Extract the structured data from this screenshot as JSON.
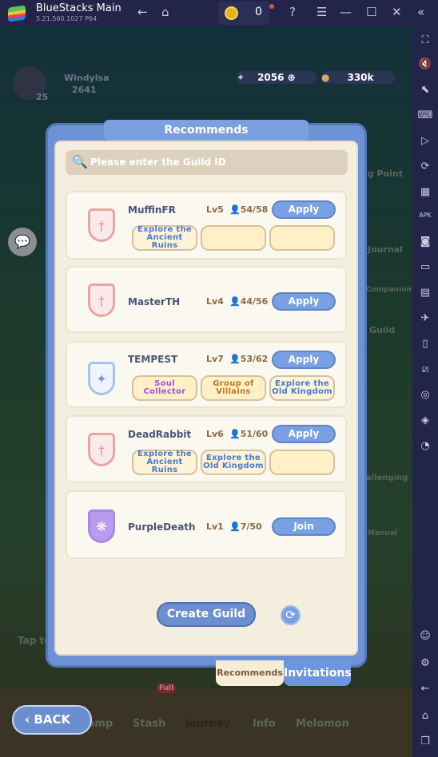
{
  "window": {
    "title": "BlueStacks Main",
    "version": "5.21.560.1027  P64",
    "coins": "0"
  },
  "hud": {
    "player_name": "Windylsa",
    "power": "2641",
    "level": "25",
    "gems": "2056",
    "gold": "330k",
    "chat_placeholder": "Tap to",
    "side_labels": [
      "Journal",
      "Companion",
      "Guild",
      "Manual",
      "allenging",
      "ng Point"
    ],
    "nav": [
      "Camp",
      "Stash",
      "Journey",
      "Info",
      "Melomon"
    ],
    "stash_badge": "Full"
  },
  "dialog": {
    "title": "Recommends",
    "search_placeholder": "Please enter the Guild ID",
    "guilds": [
      {
        "name": "MuffinFR",
        "level": "Lv5",
        "members": "54/58",
        "action": "Apply",
        "tags": [
          "Explore the Ancient Ruins",
          "",
          ""
        ]
      },
      {
        "name": "MasterTH",
        "level": "Lv4",
        "members": "44/56",
        "action": "Apply",
        "tags": []
      },
      {
        "name": "TEMPEST",
        "level": "Lv7",
        "members": "53/62",
        "action": "Apply",
        "tags": [
          "Soul Collector",
          "Group of Villains",
          "Explore the Old Kingdom"
        ]
      },
      {
        "name": "DeadRabbit",
        "level": "Lv6",
        "members": "51/60",
        "action": "Apply",
        "tags": [
          "Explore the Ancient Ruins",
          "Explore the Old Kingdom",
          ""
        ]
      },
      {
        "name": "PurpleDeath",
        "level": "Lv1",
        "members": "7/50",
        "action": "Join",
        "tags": []
      }
    ],
    "create_label": "Create Guild",
    "tabs": [
      "Recommends",
      "Invitations"
    ],
    "active_tab": "Recommends"
  },
  "back_label": "BACK",
  "colors": {
    "accent": "#79a0e2",
    "panel": "#f4eedf",
    "chrome": "#22244a"
  }
}
